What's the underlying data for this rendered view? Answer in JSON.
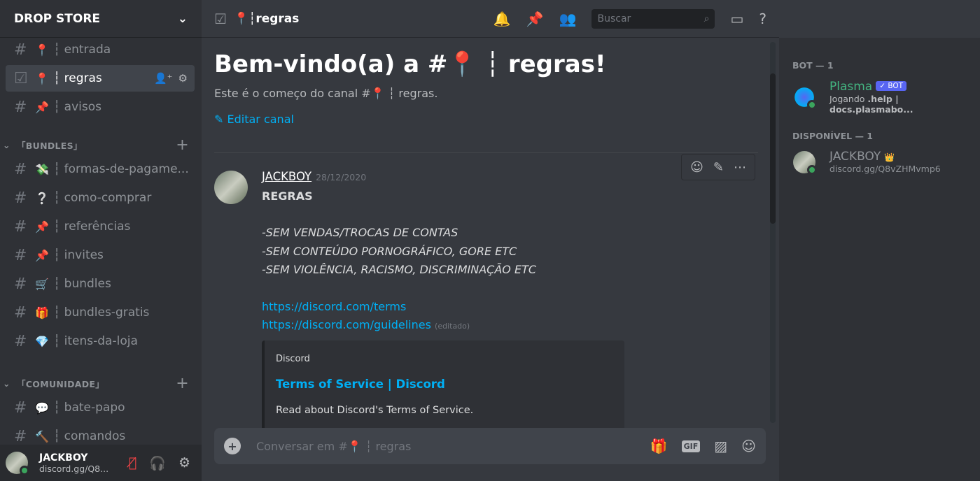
{
  "server": {
    "name": "DROP STORE"
  },
  "channels": [
    {
      "name": "entrada",
      "emoji": "📍",
      "sep": "┆"
    },
    {
      "name": "regras",
      "emoji": "📍",
      "sep": "┆",
      "active": true
    },
    {
      "name": "avisos",
      "emoji": "📌",
      "sep": "┆"
    }
  ],
  "categories": [
    {
      "name": "「BUNDLES」",
      "channels": [
        {
          "name": "formas-de-pagame...",
          "emoji": "💸",
          "sep": "┆"
        },
        {
          "name": "como-comprar",
          "emoji": "❔",
          "sep": "┆"
        },
        {
          "name": "referências",
          "emoji": "📌",
          "sep": "┆"
        },
        {
          "name": "invites",
          "emoji": "📌",
          "sep": "┆"
        },
        {
          "name": "bundles",
          "emoji": "🛒",
          "sep": "┆"
        },
        {
          "name": "bundles-gratis",
          "emoji": "🎁",
          "sep": "┆"
        },
        {
          "name": "itens-da-loja",
          "emoji": "💎",
          "sep": "┆"
        }
      ]
    },
    {
      "name": "「COMUNIDADE」",
      "channels": [
        {
          "name": "bate-papo",
          "emoji": "💬",
          "sep": "┆"
        },
        {
          "name": "comandos",
          "emoji": "🔨",
          "sep": "┆"
        }
      ]
    }
  ],
  "user": {
    "name": "JACKBOY",
    "status": "discord.gg/Q8..."
  },
  "header": {
    "channel": "📍┆regras",
    "search_placeholder": "Buscar"
  },
  "welcome": {
    "title": "Bem-vindo(a) a #📍 ┆ regras!",
    "subtitle": "Este é o começo do canal #📍 ┆ regras.",
    "edit": "Editar canal"
  },
  "message": {
    "author": "JACKBOY",
    "timestamp": "28/12/2020",
    "lines": [
      "REGRAS",
      "",
      "-SEM VENDAS/TROCAS DE CONTAS",
      "-SEM CONTEÚDO PORNOGRÁFICO, GORE ETC",
      "-SEM VIOLÊNCIA, RACISMO, DISCRIMINAÇÃO ETC"
    ],
    "links": [
      "https://discord.com/terms",
      "https://discord.com/guidelines"
    ],
    "edited": "(editado)",
    "embed": {
      "provider": "Discord",
      "title": "Terms of Service | Discord",
      "description": "Read about Discord's Terms of Service."
    }
  },
  "composer": {
    "placeholder": "Conversar em #📍 ┆ regras"
  },
  "members": {
    "groups": [
      {
        "title": "BOT — 1",
        "members": [
          {
            "name": "Plasma",
            "badge": "✓ BOT",
            "status_prefix": "Jogando ",
            "status_bold": ".help | docs.plasmabo...",
            "color": "#43b581"
          }
        ]
      },
      {
        "title": "DISPONÍVEL — 1",
        "members": [
          {
            "name": "JACKBOY",
            "crown": "👑",
            "status": "discord.gg/Q8vZHMvmp6",
            "color": "#8e9297"
          }
        ]
      }
    ]
  },
  "colors": {
    "accent": "#5865f2",
    "link": "#00aff4",
    "online": "#3ba55d"
  }
}
